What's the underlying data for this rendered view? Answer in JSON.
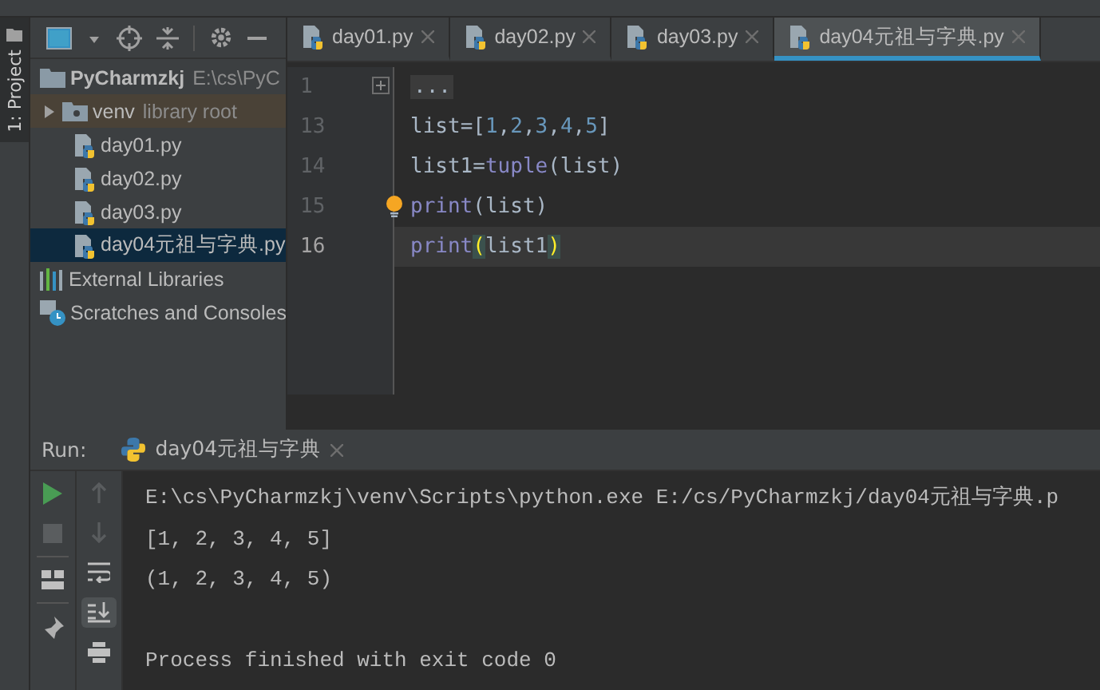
{
  "side_tab": {
    "label": "1: Project",
    "selected": true
  },
  "project_tree": [
    {
      "label": "PyCharmzkj",
      "hint": "E:\\cs\\PyC",
      "kind": "folder",
      "expanded": true,
      "selected": false,
      "children": [
        {
          "label": "venv",
          "hint": "library root",
          "kind": "libfolder",
          "expanded": false,
          "selected": false
        },
        {
          "label": "day01.py",
          "kind": "python",
          "selected": false
        },
        {
          "label": "day02.py",
          "kind": "python",
          "selected": false
        },
        {
          "label": "day03.py",
          "kind": "python",
          "selected": false
        },
        {
          "label": "day04元祖与字典.py",
          "kind": "python",
          "selected": true
        }
      ]
    },
    {
      "label": "External Libraries",
      "kind": "libraries",
      "selected": false
    },
    {
      "label": "Scratches and Consoles",
      "kind": "scratches",
      "selected": false
    }
  ],
  "editor_tabs": [
    {
      "label": "day01.py",
      "selected": false
    },
    {
      "label": "day02.py",
      "selected": false
    },
    {
      "label": "day03.py",
      "selected": false
    },
    {
      "label": "day04元祖与字典.py",
      "selected": true
    }
  ],
  "code_lines": [
    {
      "number": "1",
      "current": false,
      "tokens": [
        {
          "text": "...",
          "kind": "fold"
        }
      ]
    },
    {
      "number": "13",
      "current": false,
      "tokens": [
        {
          "text": "list",
          "kind": "name"
        },
        {
          "text": "=[",
          "kind": "punct"
        },
        {
          "text": "1",
          "kind": "number"
        },
        {
          "text": ",",
          "kind": "punct"
        },
        {
          "text": "2",
          "kind": "number"
        },
        {
          "text": ",",
          "kind": "punct"
        },
        {
          "text": "3",
          "kind": "number"
        },
        {
          "text": ",",
          "kind": "punct"
        },
        {
          "text": "4",
          "kind": "number"
        },
        {
          "text": ",",
          "kind": "punct"
        },
        {
          "text": "5",
          "kind": "number"
        },
        {
          "text": "]",
          "kind": "punct"
        }
      ]
    },
    {
      "number": "14",
      "current": false,
      "tokens": [
        {
          "text": "list1=",
          "kind": "name"
        },
        {
          "text": "tuple",
          "kind": "builtin"
        },
        {
          "text": "(list)",
          "kind": "punct"
        }
      ]
    },
    {
      "number": "15",
      "current": false,
      "tokens": [
        {
          "text": "print",
          "kind": "builtin"
        },
        {
          "text": "(list)",
          "kind": "punct"
        }
      ]
    },
    {
      "number": "16",
      "current": true,
      "tokens": [
        {
          "text": "print",
          "kind": "builtin"
        },
        {
          "text": "(",
          "kind": "brace"
        },
        {
          "text": "list1",
          "kind": "name"
        },
        {
          "text": ")",
          "kind": "brace"
        }
      ]
    }
  ],
  "run_panel": {
    "label": "Run:",
    "tab": "day04元祖与字典",
    "output": [
      "E:\\cs\\PyCharmzkj\\venv\\Scripts\\python.exe E:/cs/PyCharmzkj/day04元祖与字典.p",
      "[1, 2, 3, 4, 5]",
      "(1, 2, 3, 4, 5)"
    ],
    "exit_message": "Process finished with exit code 0"
  }
}
